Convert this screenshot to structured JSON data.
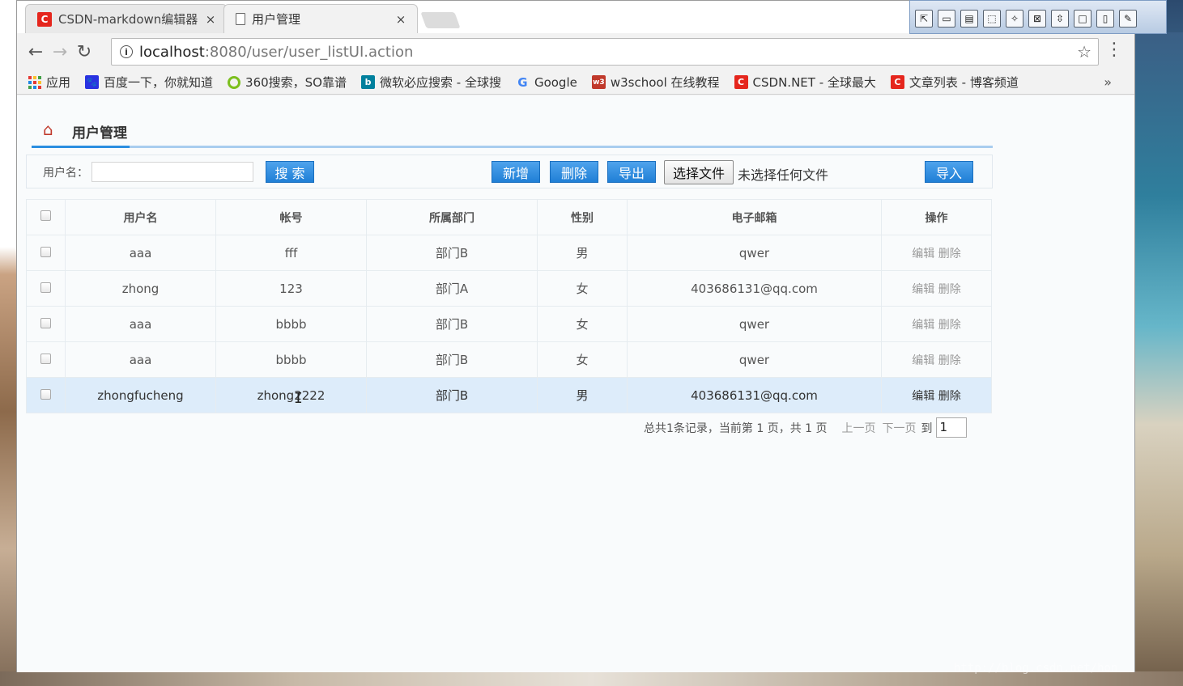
{
  "browser": {
    "tabs": [
      {
        "title": "CSDN-markdown编辑器",
        "close": "×"
      },
      {
        "title": "用户管理",
        "close": "×"
      }
    ],
    "url_host": "localhost",
    "url_path": ":8080/user/user_listUI.action",
    "bookmarks": [
      {
        "label": "应用",
        "icon": "apps-grid-icon"
      },
      {
        "label": "百度一下，你就知道",
        "icon": "baidu-paw-icon",
        "color": "#2932e1"
      },
      {
        "label": "360搜索，SO靠谱",
        "icon": "360-ring-icon",
        "color": "#7cbf1e"
      },
      {
        "label": "微软必应搜索 - 全球搜",
        "icon": "bing-icon",
        "color": "#00809d"
      },
      {
        "label": "Google",
        "icon": "google-g-icon",
        "color": "#4285f4"
      },
      {
        "label": "w3school 在线教程",
        "icon": "w3school-icon",
        "color": "#c0392b"
      },
      {
        "label": "CSDN.NET - 全球最大",
        "icon": "csdn-icon",
        "color": "#e5261d"
      },
      {
        "label": "文章列表 - 博客频道",
        "icon": "csdn-icon",
        "color": "#e5261d"
      }
    ],
    "bookmarks_more": "»"
  },
  "page": {
    "title": "用户管理",
    "search": {
      "label": "用户名：",
      "value": "",
      "search_button": "搜 索"
    },
    "actions": {
      "add": "新增",
      "delete": "删除",
      "export": "导出",
      "choose_file": "选择文件",
      "file_status": "未选择任何文件",
      "import": "导入"
    },
    "table": {
      "headers": [
        "用户名",
        "帐号",
        "所属部门",
        "性别",
        "电子邮箱",
        "操作"
      ],
      "rows": [
        {
          "username": "aaa",
          "account": "fff",
          "dept": "部门B",
          "gender": "男",
          "email": "qwer",
          "edit": "编辑",
          "delete": "删除"
        },
        {
          "username": "zhong",
          "account": "123",
          "dept": "部门A",
          "gender": "女",
          "email": "403686131@qq.com",
          "edit": "编辑",
          "delete": "删除"
        },
        {
          "username": "aaa",
          "account": "bbbb",
          "dept": "部门B",
          "gender": "女",
          "email": "qwer",
          "edit": "编辑",
          "delete": "删除"
        },
        {
          "username": "aaa",
          "account": "bbbb",
          "dept": "部门B",
          "gender": "女",
          "email": "qwer",
          "edit": "编辑",
          "delete": "删除"
        },
        {
          "username": "zhongfucheng",
          "account": "zhong2222",
          "dept": "部门B",
          "gender": "男",
          "email": "403686131@qq.com",
          "edit": "编辑",
          "delete": "删除"
        }
      ]
    },
    "pager": {
      "summary": "总共1条记录，当前第 1 页，共 1 页",
      "prev": "上一页",
      "next": "下一页",
      "goto": "到",
      "page_value": "1"
    }
  },
  "watermark": "http://blog.csdn.net/hon"
}
